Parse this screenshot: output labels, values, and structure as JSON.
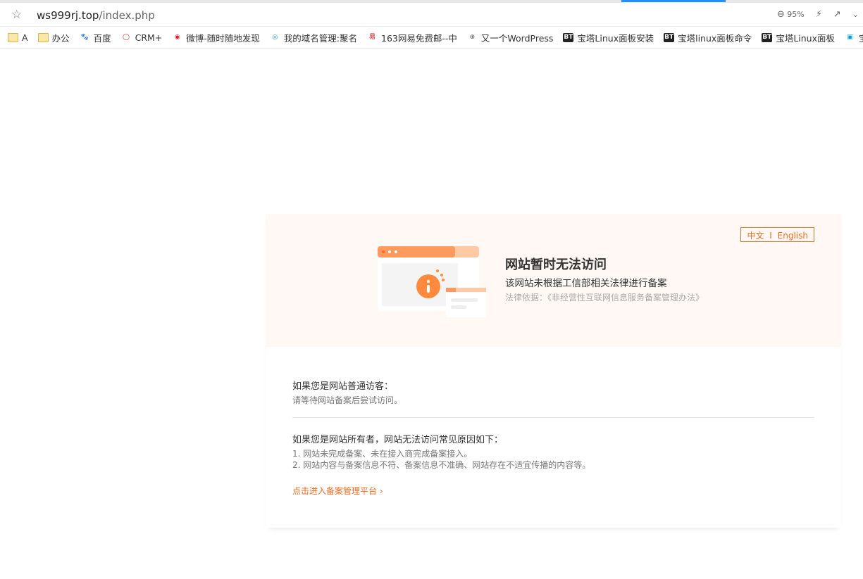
{
  "browser": {
    "url_host": "ws999rj.top",
    "url_path": "/index.php",
    "zoom": "95%",
    "bookmarks": [
      {
        "icon": "folder-icon",
        "label": "A"
      },
      {
        "icon": "folder-icon",
        "label": "办公"
      },
      {
        "icon": "baidu-icon",
        "label": "百度"
      },
      {
        "icon": "crm-icon",
        "label": "CRM+"
      },
      {
        "icon": "weibo-icon",
        "label": "微博-随时随地发现"
      },
      {
        "icon": "domain-icon",
        "label": "我的域名管理:聚名"
      },
      {
        "icon": "163-icon",
        "label": "163网易免费邮--中"
      },
      {
        "icon": "globe-icon",
        "label": "又一个WordPress"
      },
      {
        "icon": "bt-icon",
        "label": "宝塔Linux面板安装"
      },
      {
        "icon": "bt-icon",
        "label": "宝塔linux面板命令"
      },
      {
        "icon": "bt-icon",
        "label": "宝塔Linux面板"
      },
      {
        "icon": "bilibili-icon",
        "label": "宝塔面板运"
      }
    ]
  },
  "notice": {
    "lang_zh": "中文",
    "lang_sep": "I",
    "lang_en": "English",
    "title": "网站暂时无法访问",
    "subtitle": "该网站未根据工信部相关法律进行备案",
    "law": "法律依据：《非经营性互联网信息服务备案管理办法》"
  },
  "visitor": {
    "heading": "如果您是网站普通访客：",
    "text": "请等待网站备案后尝试访问。"
  },
  "owner": {
    "heading": "如果您是网站所有者，网站无法访问常见原因如下：",
    "reasons": [
      "1. 网站未完成备案、未在接入商完成备案接入。",
      "2. 网站内容与备案信息不符、备案信息不准确、网站存在不适宜传播的内容等。"
    ]
  },
  "link": {
    "label": "点击进入备案管理平台",
    "arrow": "›"
  },
  "colors": {
    "accent": "#f06b1f",
    "banner_bg": "#fff8f5"
  }
}
